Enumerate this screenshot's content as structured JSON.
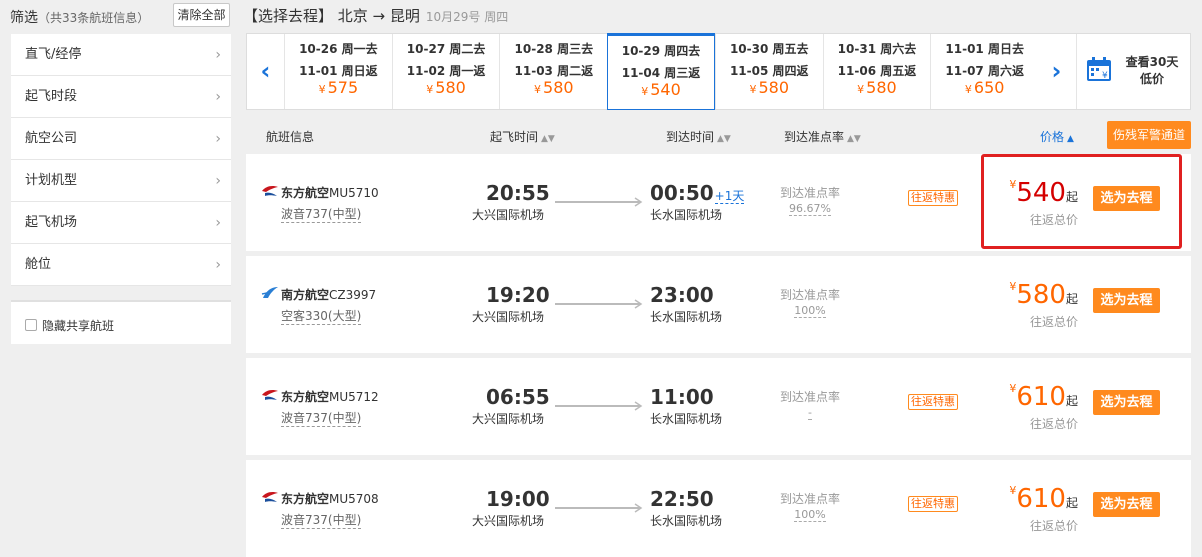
{
  "header": {
    "filter_title": "筛选",
    "filter_count": "（共33条航班信息）",
    "clear_all": "清除全部",
    "route_title": "【选择去程】 北京 → 昆明",
    "route_date": "10月29号 周四"
  },
  "sidebar": {
    "items": [
      {
        "label": "直飞/经停"
      },
      {
        "label": "起飞时段"
      },
      {
        "label": "航空公司"
      },
      {
        "label": "计划机型"
      },
      {
        "label": "起飞机场"
      },
      {
        "label": "舱位"
      }
    ],
    "hide_shared_label": "隐藏共享航班",
    "hide_shared_checked": false
  },
  "dates": [
    {
      "go": "10-26 周一去",
      "back": "11-01 周日返",
      "price": "575",
      "active": false
    },
    {
      "go": "10-27 周二去",
      "back": "11-02 周一返",
      "price": "580",
      "active": false
    },
    {
      "go": "10-28 周三去",
      "back": "11-03 周二返",
      "price": "580",
      "active": false
    },
    {
      "go": "10-29 周四去",
      "back": "11-04 周三返",
      "price": "540",
      "active": true
    },
    {
      "go": "10-30 周五去",
      "back": "11-05 周四返",
      "price": "580",
      "active": false
    },
    {
      "go": "10-31 周六去",
      "back": "11-06 周五返",
      "price": "580",
      "active": false
    },
    {
      "go": "11-01 周日去",
      "back": "11-07 周六返",
      "price": "650",
      "active": false
    }
  ],
  "calendar": {
    "line1": "查看30天",
    "line2": "低价"
  },
  "currency_symbol": "¥",
  "list_header": {
    "flight_info": "航班信息",
    "dep_time": "起飞时间",
    "arr_time": "到达时间",
    "on_time": "到达准点率",
    "price": "价格",
    "disabled_channel": "伤残军警通道"
  },
  "flights": [
    {
      "airline": "东方航空",
      "flight_no": "MU5710",
      "plane": "波音737(中型)",
      "dep_time": "20:55",
      "dep_airport": "大兴国际机场",
      "arr_time": "00:50",
      "next_day": "+1天",
      "arr_airport": "长水国际机场",
      "otp_label": "到达准点率",
      "otp": "96.67%",
      "tag": "往返特惠",
      "price": "540",
      "qi": "起",
      "price_sub": "往返总价",
      "select": "选为去程",
      "logo": "china-eastern"
    },
    {
      "airline": "南方航空",
      "flight_no": "CZ3997",
      "plane": "空客330(大型)",
      "dep_time": "19:20",
      "dep_airport": "大兴国际机场",
      "arr_time": "23:00",
      "next_day": "",
      "arr_airport": "长水国际机场",
      "otp_label": "到达准点率",
      "otp": "100%",
      "tag": "",
      "price": "580",
      "qi": "起",
      "price_sub": "往返总价",
      "select": "选为去程",
      "logo": "china-southern"
    },
    {
      "airline": "东方航空",
      "flight_no": "MU5712",
      "plane": "波音737(中型)",
      "dep_time": "06:55",
      "dep_airport": "大兴国际机场",
      "arr_time": "11:00",
      "next_day": "",
      "arr_airport": "长水国际机场",
      "otp_label": "到达准点率",
      "otp": "-",
      "tag": "往返特惠",
      "price": "610",
      "qi": "起",
      "price_sub": "往返总价",
      "select": "选为去程",
      "logo": "china-eastern"
    },
    {
      "airline": "东方航空",
      "flight_no": "MU5708",
      "plane": "波音737(中型)",
      "dep_time": "19:00",
      "dep_airport": "大兴国际机场",
      "arr_time": "22:50",
      "next_day": "",
      "arr_airport": "长水国际机场",
      "otp_label": "到达准点率",
      "otp": "100%",
      "tag": "往返特惠",
      "price": "610",
      "qi": "起",
      "price_sub": "往返总价",
      "select": "选为去程",
      "logo": "china-eastern"
    }
  ],
  "colors": {
    "accent": "#1a73d9",
    "price": "#ff6600",
    "button": "#ff8a1e",
    "highlight": "#e02020"
  }
}
